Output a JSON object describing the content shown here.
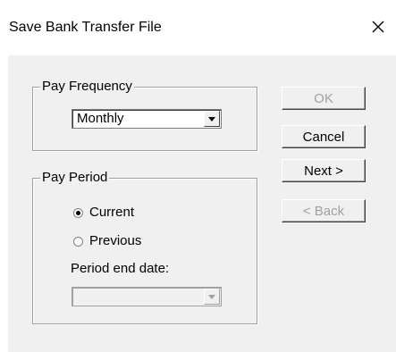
{
  "dialog": {
    "title": "Save Bank Transfer File",
    "close_icon": "close-icon"
  },
  "pay_frequency": {
    "group_label": "Pay Frequency",
    "selected": "Monthly"
  },
  "pay_period": {
    "group_label": "Pay Period",
    "options": [
      {
        "label": "Current",
        "checked": true
      },
      {
        "label": "Previous",
        "checked": false
      }
    ],
    "end_date_label": "Period end date:",
    "end_date_value": ""
  },
  "buttons": {
    "ok": "OK",
    "cancel": "Cancel",
    "next": "Next >",
    "back": "< Back"
  },
  "colors": {
    "dialog_background": "#f0f0f0",
    "disabled_text": "#a0a0a0"
  }
}
